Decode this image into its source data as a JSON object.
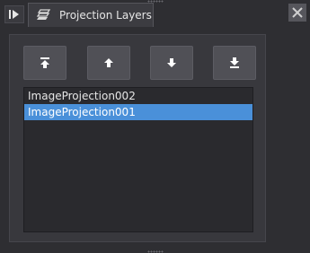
{
  "window": {
    "tab_title": "Projection Layers",
    "tab_icon": "layers-icon",
    "float_icon": "dock-float-icon",
    "close_icon": "close-icon"
  },
  "toolbar": [
    {
      "name": "move-to-top-button",
      "icon": "arrow-to-top-icon"
    },
    {
      "name": "move-up-button",
      "icon": "arrow-up-icon"
    },
    {
      "name": "move-down-button",
      "icon": "arrow-down-icon"
    },
    {
      "name": "move-to-bottom-button",
      "icon": "arrow-to-bottom-icon"
    }
  ],
  "layers": {
    "items": [
      {
        "label": "ImageProjection002",
        "selected": false
      },
      {
        "label": "ImageProjection001",
        "selected": true
      }
    ]
  },
  "colors": {
    "selection": "#4a90d9",
    "background": "#2e2e32"
  }
}
